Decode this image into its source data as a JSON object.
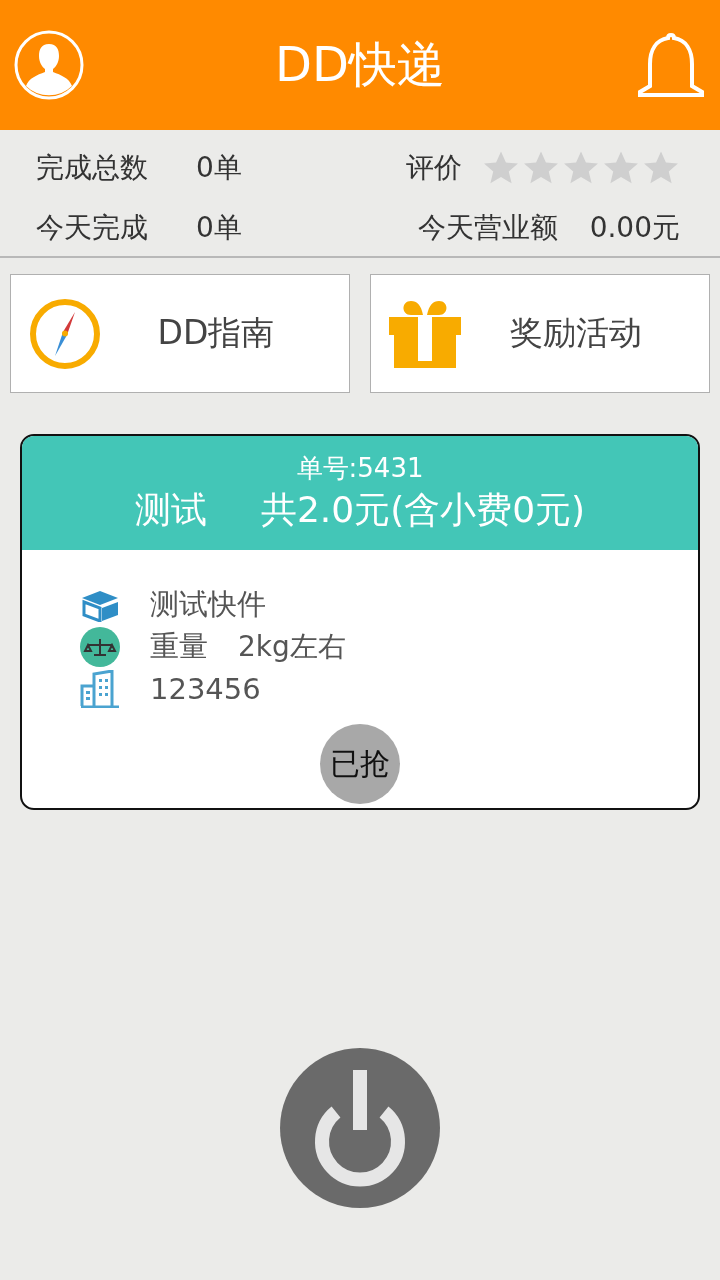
{
  "header": {
    "title": "DD快递"
  },
  "stats": {
    "total_label": "完成总数",
    "total_value": "0单",
    "rating_label": "评价",
    "rating_stars": {
      "stars": 0
    },
    "today_label": "今天完成",
    "today_value": "0单",
    "revenue_label": "今天营业额",
    "revenue_value": "0.00元"
  },
  "shortcuts": [
    {
      "kind": "compass",
      "label": "DD指南"
    },
    {
      "kind": "gift",
      "label": "奖励活动"
    }
  ],
  "order": {
    "number": "单号:5431",
    "name": "测试",
    "price": "共2.0元(含小费0元)",
    "item": "测试快件",
    "weight_label": "重量",
    "weight_value": "2kg左右",
    "address": "123456",
    "status": "已抢"
  }
}
